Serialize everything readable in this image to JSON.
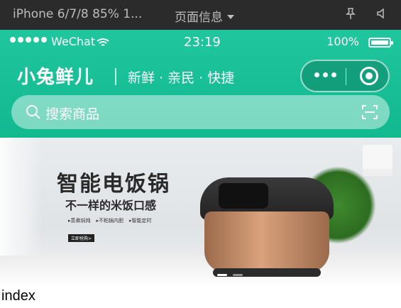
{
  "devbar": {
    "device": "iPhone 6/7/8 85% 1...",
    "page_info": "页面信息",
    "icons": [
      "pin-icon",
      "speaker-icon"
    ]
  },
  "status_bar": {
    "carrier": "WeChat",
    "time": "23:19",
    "battery": "100%"
  },
  "header": {
    "brand": "小兔鲜儿",
    "slogan": "新鲜 · 亲民 · 快捷"
  },
  "search": {
    "placeholder": "搜索商品"
  },
  "banner": {
    "title": "智能电饭锅",
    "subtitle": "不一样的米饭口感",
    "features": [
      "▸蒸煮焖炖",
      "▸不粘锅内胆",
      "▸智能定时"
    ],
    "cta": "立即抢购>",
    "indicator_count": 2,
    "active_index": 0
  },
  "page": {
    "label": "index"
  },
  "colors": {
    "brand_green": "#1fc69e",
    "devbar_bg": "#2b2b2b"
  }
}
